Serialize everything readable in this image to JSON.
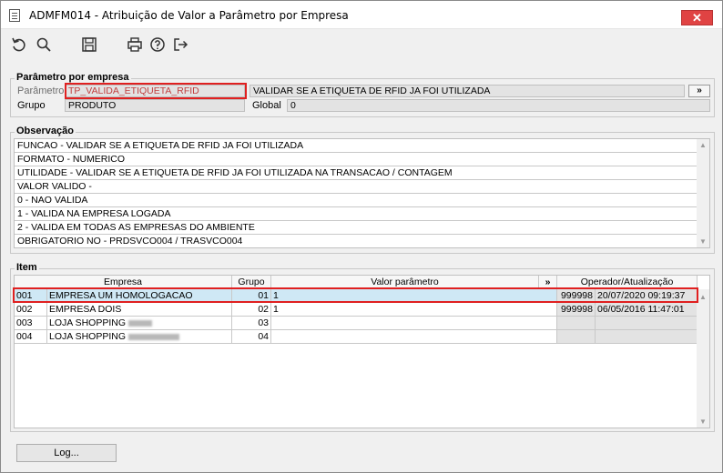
{
  "window": {
    "title": "ADMFM014 - Atribuição de Valor a Parâmetro por Empresa",
    "close": "✕"
  },
  "toolbar": {
    "icons": [
      "undo-icon",
      "search-icon",
      "save-icon",
      "print-icon",
      "help-icon",
      "exit-icon"
    ]
  },
  "param": {
    "group_title": "Parâmetro por empresa",
    "parametro_label": "Parâmetro",
    "parametro_value": "TP_VALIDA_ETIQUETA_RFID",
    "descricao_value": "VALIDAR SE A ETIQUETA DE RFID JA FOI UTILIZADA",
    "more_button": "»",
    "grupo_label": "Grupo",
    "grupo_value": "PRODUTO",
    "global_label": "Global",
    "global_value": "0"
  },
  "obs": {
    "title": "Observação",
    "lines": [
      "FUNCAO - VALIDAR SE A ETIQUETA DE RFID JA FOI UTILIZADA",
      "FORMATO - NUMERICO",
      "UTILIDADE - VALIDAR SE A ETIQUETA DE RFID JA FOI UTILIZADA NA TRANSACAO / CONTAGEM",
      "VALOR VALIDO -",
      "0 - NAO VALIDA",
      "1 - VALIDA NA EMPRESA LOGADA",
      "2 - VALIDA EM TODAS AS EMPRESAS DO AMBIENTE",
      "OBRIGATORIO NO - PRDSVCO004 / TRASVCO004"
    ]
  },
  "item": {
    "title": "Item",
    "headers": {
      "empresa": "Empresa",
      "grupo": "Grupo",
      "valor": "Valor parâmetro",
      "more": "»",
      "operador": "Operador/Atualização"
    },
    "rows": [
      {
        "code": "001",
        "empresa": "EMPRESA UM HOMOLOGACAO",
        "grupo": "01",
        "valor": "1",
        "operador": "999998",
        "atualizacao": "20/07/2020 09:19:37"
      },
      {
        "code": "002",
        "empresa": "EMPRESA DOIS",
        "grupo": "02",
        "valor": "1",
        "operador": "999998",
        "atualizacao": "06/05/2016 11:47:01"
      },
      {
        "code": "003",
        "empresa": "LOJA SHOPPING",
        "grupo": "03",
        "valor": "",
        "operador": "",
        "atualizacao": ""
      },
      {
        "code": "004",
        "empresa": "LOJA SHOPPING",
        "grupo": "04",
        "valor": "",
        "operador": "",
        "atualizacao": ""
      }
    ]
  },
  "footer": {
    "log_button": "Log..."
  },
  "colors": {
    "highlight_red": "#e02020",
    "selected_row": "#cfe8f5",
    "close_red": "#e04343"
  }
}
